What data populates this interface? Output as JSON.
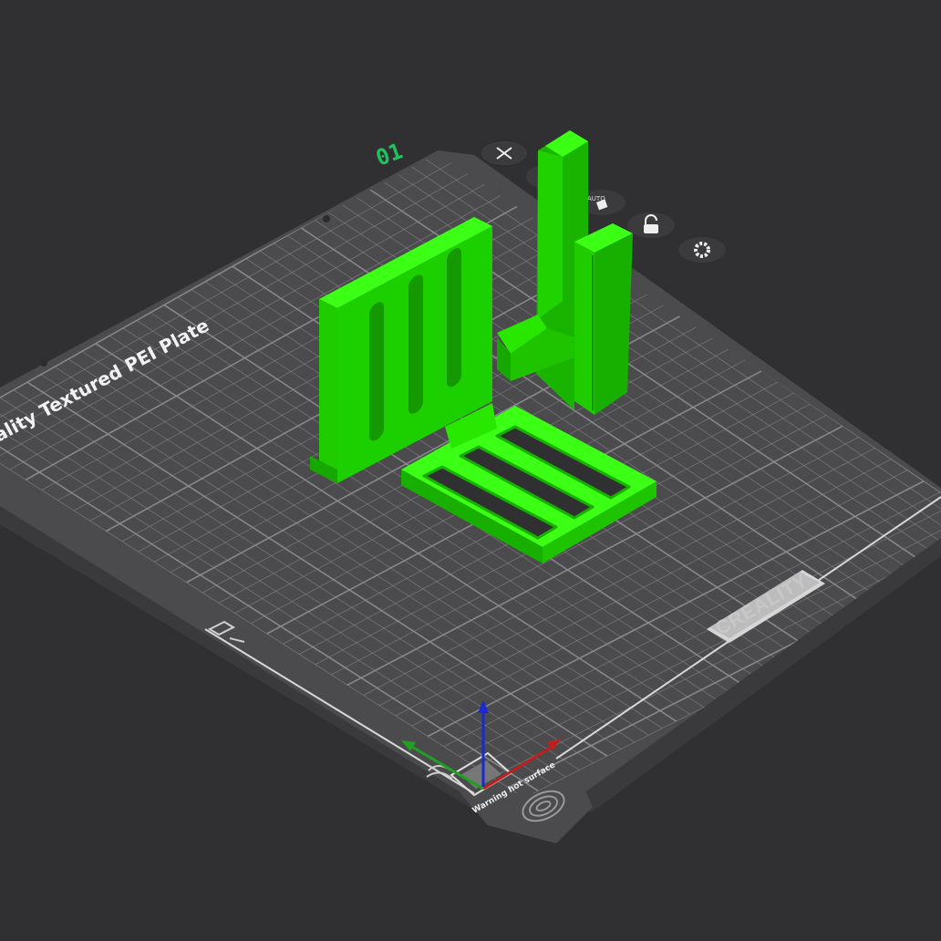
{
  "plate": {
    "number": "01",
    "bed_label": "ality Textured PEI Plate",
    "brand": "CREALITY",
    "warning": "Warning hot surface"
  },
  "plate_toolbar": {
    "auto_label": "AUTO"
  },
  "colors": {
    "background": "#303033",
    "bed": "#4a4a4d",
    "grid": "#8e8e92",
    "model": "#22e000",
    "axis_x": "#c21e1e",
    "axis_y": "#20a020",
    "axis_z": "#1a2ad0",
    "plate_number": "#21c25e"
  },
  "icons": [
    "close-icon",
    "auto-orient-icon",
    "lock-icon",
    "gear-icon",
    "fingerprint-icon",
    "warning-hot-icon",
    "origin-icon"
  ]
}
